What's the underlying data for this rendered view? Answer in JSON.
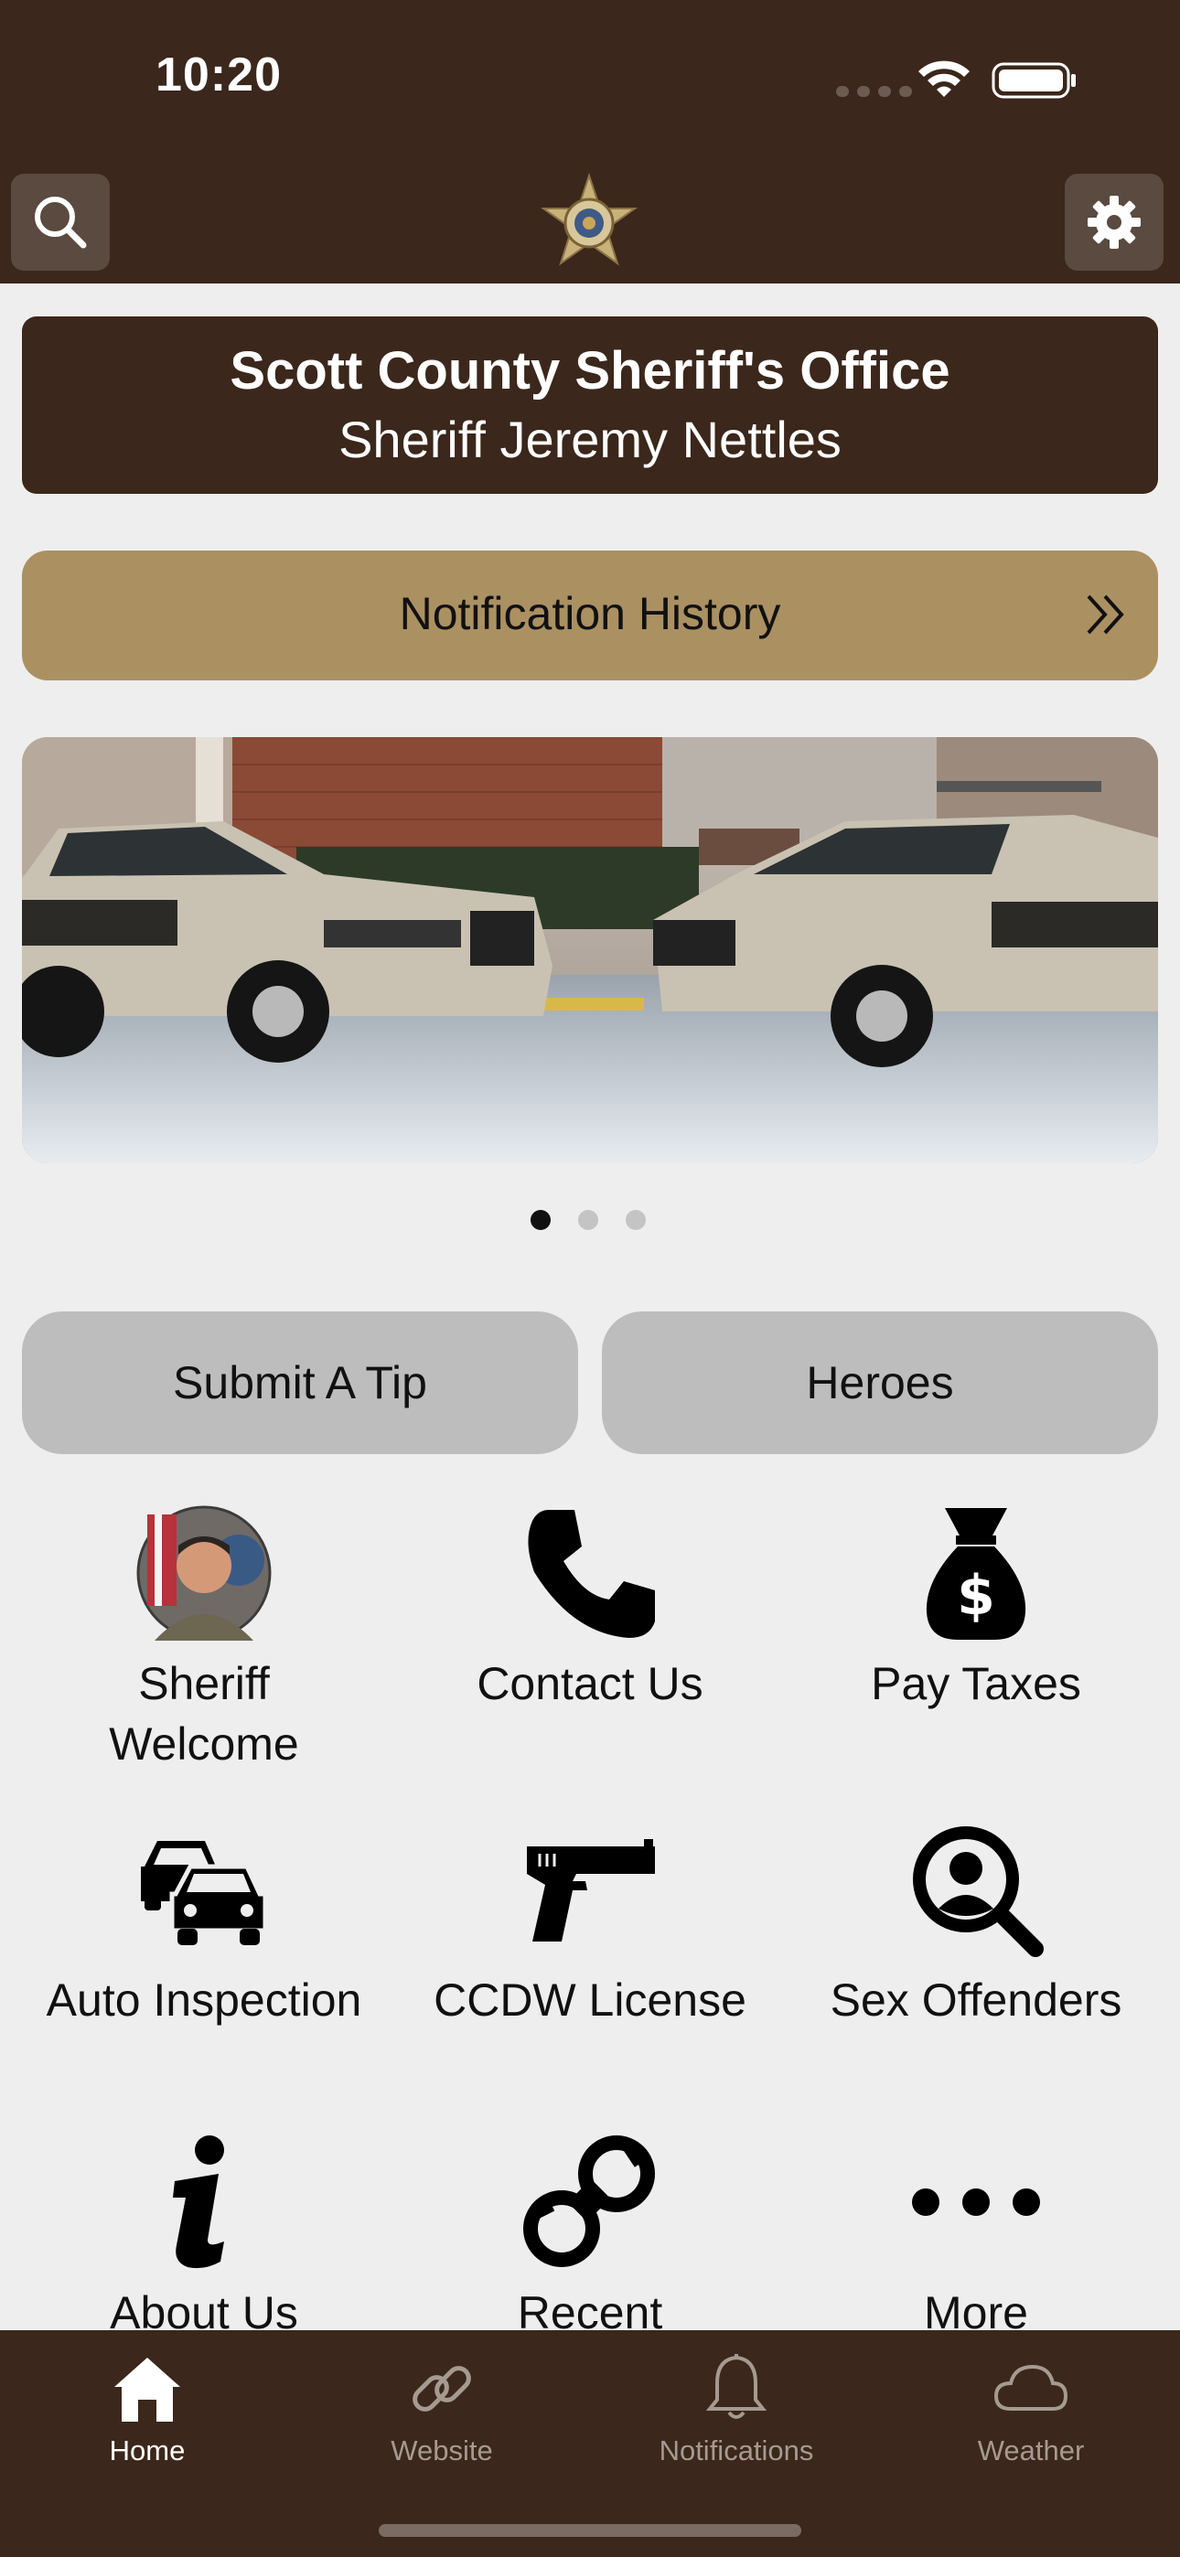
{
  "status_bar": {
    "time": "10:20"
  },
  "header": {
    "search_icon": "search-icon",
    "settings_icon": "gear-icon",
    "logo": "sheriff-star-badge"
  },
  "banner": {
    "title": "Scott County Sheriff's Office",
    "subtitle": "Sheriff Jeremy Nettles"
  },
  "notification_history": {
    "label": "Notification History"
  },
  "carousel": {
    "page_count": 3,
    "active_index": 0
  },
  "quick_buttons": [
    {
      "label": "Submit A Tip"
    },
    {
      "label": "Heroes"
    }
  ],
  "grid": [
    {
      "label": "Sheriff Welcome",
      "icon": "sheriff-photo"
    },
    {
      "label": "Contact Us",
      "icon": "phone-icon"
    },
    {
      "label": "Pay Taxes",
      "icon": "money-bag-icon"
    },
    {
      "label": "Auto Inspection",
      "icon": "cars-icon"
    },
    {
      "label": "CCDW License",
      "icon": "handgun-icon"
    },
    {
      "label": "Sex Offenders",
      "icon": "user-search-icon"
    },
    {
      "label": "About Us",
      "icon": "info-icon"
    },
    {
      "label": "Recent",
      "icon": "handcuffs-icon"
    },
    {
      "label": "More",
      "icon": "ellipsis-icon"
    }
  ],
  "tab_bar": {
    "tabs": [
      {
        "label": "Home",
        "icon": "home-icon",
        "active": true
      },
      {
        "label": "Website",
        "icon": "link-icon",
        "active": false
      },
      {
        "label": "Notifications",
        "icon": "bell-icon",
        "active": false
      },
      {
        "label": "Weather",
        "icon": "cloud-icon",
        "active": false
      }
    ]
  },
  "colors": {
    "brand_dark": "#3b271b",
    "gold": "#ab9062",
    "background": "#eeeeee",
    "pill_gray": "#bdbdbd"
  }
}
